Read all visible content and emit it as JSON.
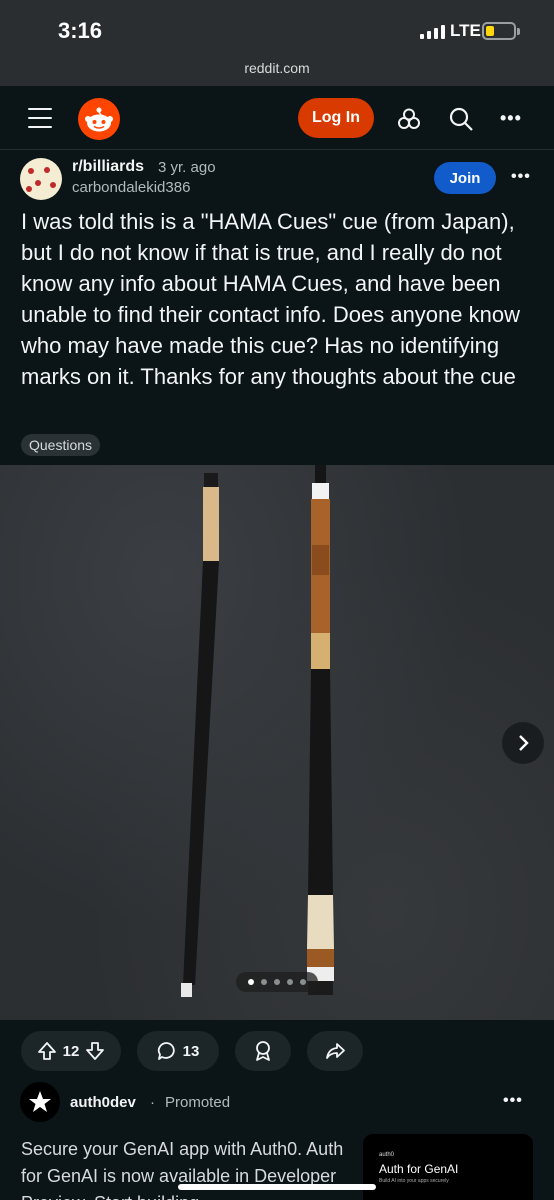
{
  "status_bar": {
    "time": "3:16",
    "network": "LTE",
    "url": "reddit.com"
  },
  "header": {
    "login_label": "Log In"
  },
  "post": {
    "subreddit": "r/billiards",
    "age": "3 yr. ago",
    "author": "carbondalekid386",
    "join_label": "Join",
    "title": "I was told this is a \"HAMA Cues\" cue (from Japan), but I do not know if that is true, and I really do not know any info about HAMA Cues, and have been unable to find their contact info. Does anyone know who may have made this cue? Has no identifying marks on it. Thanks for any thoughts about the cue",
    "flair": "Questions",
    "image_count": 5,
    "current_image": 1,
    "upvotes": "12",
    "comments": "13"
  },
  "promoted": {
    "name": "auth0dev",
    "separator": "·",
    "tag": "Promoted",
    "text": "Secure your GenAI app with Auth0. Auth for GenAI is now available in Developer Preview. Start building",
    "card_brand": "auth0",
    "card_title": "Auth for GenAI",
    "card_sub": "Build AI into your apps securely"
  },
  "colors": {
    "accent": "#ff4500",
    "login": "#d93a00",
    "join": "#115bca",
    "background": "#0b1416"
  },
  "icons": [
    "menu-icon",
    "reddit-logo-icon",
    "popular-icon",
    "search-icon",
    "more-icon",
    "upvote-icon",
    "downvote-icon",
    "comment-icon",
    "award-icon",
    "share-icon",
    "chevron-right-icon"
  ]
}
